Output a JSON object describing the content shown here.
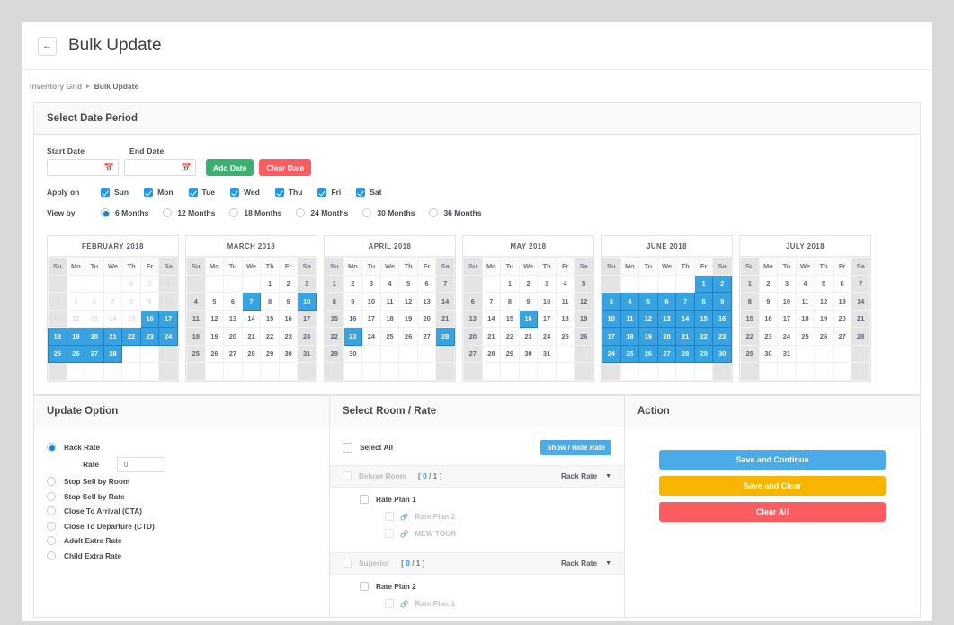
{
  "header": {
    "back_icon": "arrow-left-icon",
    "title": "Bulk Update"
  },
  "breadcrumb": {
    "items": [
      "Inventory Grid",
      "Bulk Update"
    ],
    "separator": "▸"
  },
  "date_period": {
    "panel_title": "Select Date Period",
    "start_label": "Start Date",
    "end_label": "End Date",
    "start_value": "",
    "end_value": "",
    "start_placeholder": "",
    "end_placeholder": "",
    "calendar_icon": "calendar-icon",
    "add_date_label": "Add Date",
    "clear_date_label": "Clear Date",
    "add_date_color": "#3ab26d",
    "clear_date_color": "#fb5c60",
    "apply_on_label": "Apply on",
    "days": [
      {
        "label": "Sun",
        "checked": true
      },
      {
        "label": "Mon",
        "checked": true
      },
      {
        "label": "Tue",
        "checked": true
      },
      {
        "label": "Wed",
        "checked": true
      },
      {
        "label": "Thu",
        "checked": true
      },
      {
        "label": "Fri",
        "checked": true
      },
      {
        "label": "Sat",
        "checked": true
      }
    ],
    "view_by_label": "View by",
    "view_options": [
      {
        "label": "6 Months",
        "selected": true
      },
      {
        "label": "12 Months",
        "selected": false
      },
      {
        "label": "18 Months",
        "selected": false
      },
      {
        "label": "24 Months",
        "selected": false
      },
      {
        "label": "30 Months",
        "selected": false
      },
      {
        "label": "36 Months",
        "selected": false
      }
    ]
  },
  "calendar": {
    "weekday_headers": [
      "Su",
      "Mo",
      "Tu",
      "We",
      "Th",
      "Fr",
      "Sa"
    ],
    "selected_color": "#38a3e0",
    "months": [
      {
        "title": "FEBRUARY 2018",
        "first_weekday": 4,
        "days_in_month": 28,
        "disabled_days": [
          1,
          2,
          3,
          4,
          5,
          6,
          7,
          8,
          9,
          10,
          11,
          12,
          13,
          14,
          15
        ],
        "selected_days": [
          16,
          17,
          18,
          19,
          20,
          21,
          22,
          23,
          24,
          25,
          26,
          27,
          28
        ]
      },
      {
        "title": "MARCH 2018",
        "first_weekday": 4,
        "days_in_month": 31,
        "disabled_days": [],
        "selected_days": [
          7,
          10
        ]
      },
      {
        "title": "APRIL 2018",
        "first_weekday": 0,
        "days_in_month": 30,
        "disabled_days": [],
        "selected_days": [
          23,
          28
        ]
      },
      {
        "title": "MAY 2018",
        "first_weekday": 2,
        "days_in_month": 31,
        "disabled_days": [],
        "selected_days": [
          16
        ]
      },
      {
        "title": "JUNE 2018",
        "first_weekday": 5,
        "days_in_month": 30,
        "disabled_days": [],
        "selected_days": [
          1,
          2,
          3,
          4,
          5,
          6,
          7,
          8,
          9,
          10,
          11,
          12,
          13,
          14,
          15,
          16,
          17,
          18,
          19,
          20,
          21,
          22,
          23,
          24,
          25,
          26,
          27,
          28,
          29,
          30
        ]
      },
      {
        "title": "JULY 2018",
        "first_weekday": 0,
        "days_in_month": 31,
        "disabled_days": [],
        "selected_days": []
      }
    ]
  },
  "update_option": {
    "panel_title": "Update Option",
    "options": [
      {
        "label": "Rack Rate",
        "selected": true
      },
      {
        "label": "Stop Sell by Room",
        "selected": false
      },
      {
        "label": "Stop Sell by Rate",
        "selected": false
      },
      {
        "label": "Close To Arrival (CTA)",
        "selected": false
      },
      {
        "label": "Close To Departure (CTD)",
        "selected": false
      },
      {
        "label": "Adult Extra Rate",
        "selected": false
      },
      {
        "label": "Child Extra Rate",
        "selected": false
      }
    ],
    "rate_label": "Rate",
    "rate_value": "0"
  },
  "select_room_rate": {
    "panel_title": "Select Room / Rate",
    "select_all_label": "Select All",
    "show_hide_label": "Show / Hide Rate",
    "show_hide_color": "#4aabe8",
    "rooms": [
      {
        "name": "Deluxe Room",
        "count": "[ 0 / 1 ]",
        "count_current": "0",
        "count_total": "1",
        "rate_label": "Rack Rate",
        "caret_icon": "chevron-down-icon",
        "plans": [
          {
            "label": "Rate Plan 1",
            "children": [
              {
                "label": "Rate Plan 2",
                "icon": "link-icon"
              },
              {
                "label": "MEW TOUR",
                "icon": "link-icon"
              }
            ]
          }
        ]
      },
      {
        "name": "Superior",
        "count": "[ 0 / 1 ]",
        "count_current": "0",
        "count_total": "1",
        "rate_label": "Rack Rate",
        "caret_icon": "chevron-down-icon",
        "plans": [
          {
            "label": "Rate Plan 2",
            "children": [
              {
                "label": "Rate Plan 1",
                "icon": "link-icon"
              }
            ]
          }
        ]
      }
    ]
  },
  "action": {
    "panel_title": "Action",
    "buttons": [
      {
        "label": "Save and Continue",
        "color": "#4aabe8"
      },
      {
        "label": "Save and Clear",
        "color": "#f7b500"
      },
      {
        "label": "Clear All",
        "color": "#fb5c60"
      }
    ]
  }
}
